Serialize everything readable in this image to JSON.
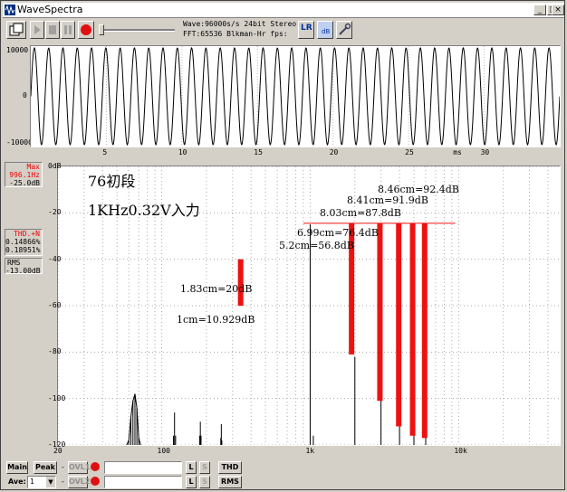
{
  "window": {
    "title": "WaveSpectra",
    "min_label": "_",
    "max_label": "□",
    "close_label": "×"
  },
  "toolbar": {
    "wave_info": "Wave:96000s/s 24bit Stereo",
    "fft_info": "FFT:65536 Blkman-Hr fps:",
    "lr_label": "LR",
    "db_label": "dB"
  },
  "waveform": {
    "y_ticks": [
      "10000",
      "0",
      "-10000"
    ],
    "x_ticks": [
      "5",
      "10",
      "15",
      "20",
      "25",
      "30"
    ],
    "x_unit": "ms",
    "cycles": 37
  },
  "readouts": {
    "max_label": "Max",
    "max_freq": "996.1Hz",
    "max_db": "-25.0dB",
    "thd_label": "THD.+N",
    "thd_val1": "0.14866%",
    "thd_val2": "0.18951%",
    "rms_label": "RMS",
    "rms_val": "-13.00dB"
  },
  "annotations": {
    "title": "76初段",
    "subtitle": "1KHz0.32V入力",
    "scale_1": "1.83cm=20dB",
    "scale_2": "1cm=10.929dB",
    "h2": "5.2cm=56.8dB",
    "h3": "6.99cm=76.4dB",
    "h4": "8.03cm=87.8dB",
    "h5": "8.41cm=91.9dB",
    "h6": "8.46cm=92.4dB"
  },
  "chart_data": {
    "type": "line",
    "y_ticks": [
      "0dB",
      "-20",
      "-40",
      "-60",
      "-80",
      "-100",
      "-120"
    ],
    "ylim": [
      -120,
      0
    ],
    "x_ticks": [
      "20",
      "100",
      "1k",
      "10k"
    ],
    "x_scale": "log",
    "xlim": [
      20,
      48000
    ],
    "series": [
      {
        "values": [
          [
            60,
            -118
          ],
          [
            62,
            -108
          ],
          [
            64,
            -101
          ],
          [
            66,
            -98
          ],
          [
            68,
            -104
          ],
          [
            70,
            -117
          ],
          [
            120,
            -116
          ],
          [
            122,
            -106
          ],
          [
            124,
            -116
          ],
          [
            180,
            -116
          ],
          [
            182,
            -110
          ],
          [
            184,
            -116
          ],
          [
            250,
            -117
          ],
          [
            252,
            -111
          ],
          [
            254,
            -118
          ],
          [
            1000,
            -25
          ],
          [
            1050,
            -116
          ],
          [
            2000,
            -82
          ],
          [
            3000,
            -94
          ],
          [
            4000,
            -112
          ],
          [
            5000,
            -114
          ],
          [
            6000,
            -116
          ]
        ]
      }
    ],
    "reference_line_db": -24.5,
    "red_bars": [
      {
        "freq": 340,
        "top": -40,
        "bottom": -60
      },
      {
        "freq": 1900,
        "top": -24.5,
        "bottom": -81
      },
      {
        "freq": 2950,
        "top": -24.5,
        "bottom": -101
      },
      {
        "freq": 3950,
        "top": -24.5,
        "bottom": -112
      },
      {
        "freq": 4900,
        "top": -24.5,
        "bottom": -116
      },
      {
        "freq": 5900,
        "top": -24.5,
        "bottom": -117
      }
    ]
  },
  "bottom": {
    "main_label": "Main",
    "peak_label": "Peak",
    "ovl1_label": "OVL1",
    "ovl2_label": "OVL2",
    "ave_label": "Ave:",
    "ave_value": "1",
    "l_label": "L",
    "s_label": "S",
    "thd_label": "THD",
    "rms_label": "RMS",
    "dash": "-"
  },
  "colors": {
    "marker_red": "#ee1111",
    "grid": "#aaaaaa"
  }
}
